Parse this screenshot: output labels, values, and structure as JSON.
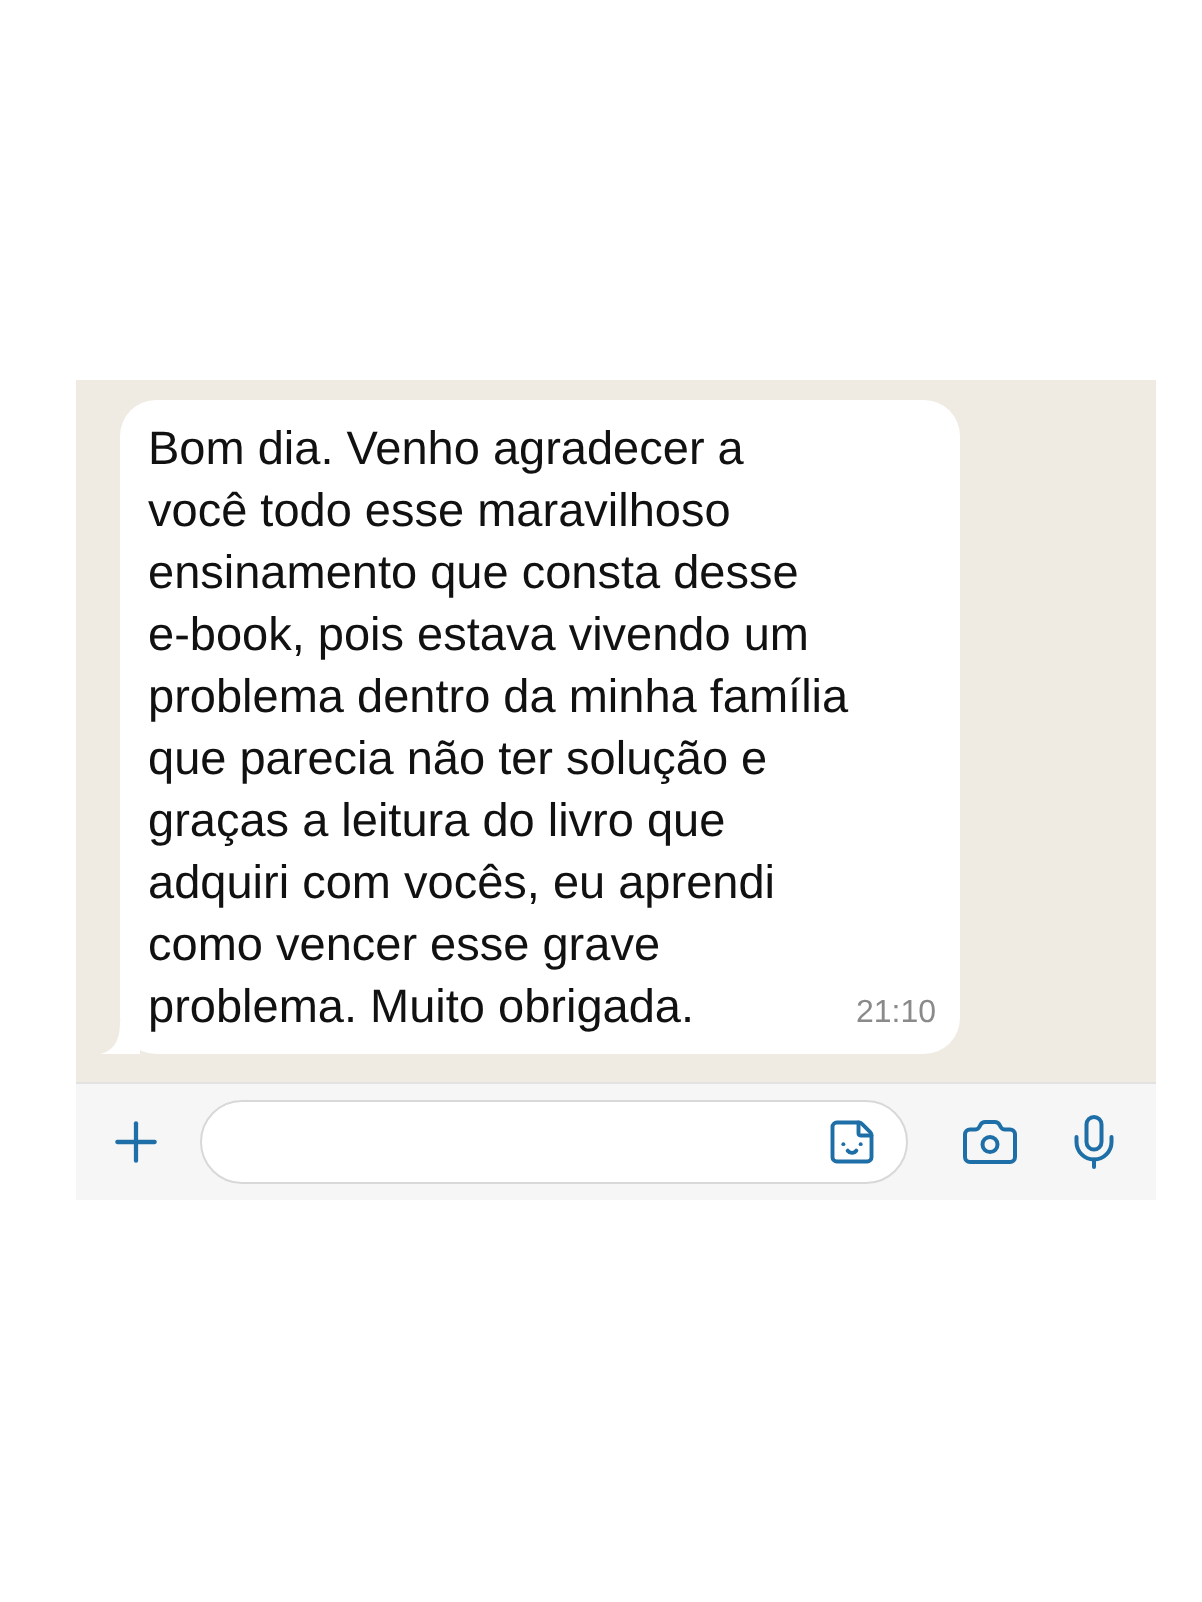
{
  "message": {
    "text": "Bom dia. Venho agradecer a você todo esse maravilhoso ensinamento que consta desse e-book, pois estava vivendo um problema dentro da minha família que parecia não ter solução e graças a leitura do livro que adquiri com vocês, eu aprendi como vencer esse grave problema. Muito obrigada.",
    "time": "21:10"
  }
}
